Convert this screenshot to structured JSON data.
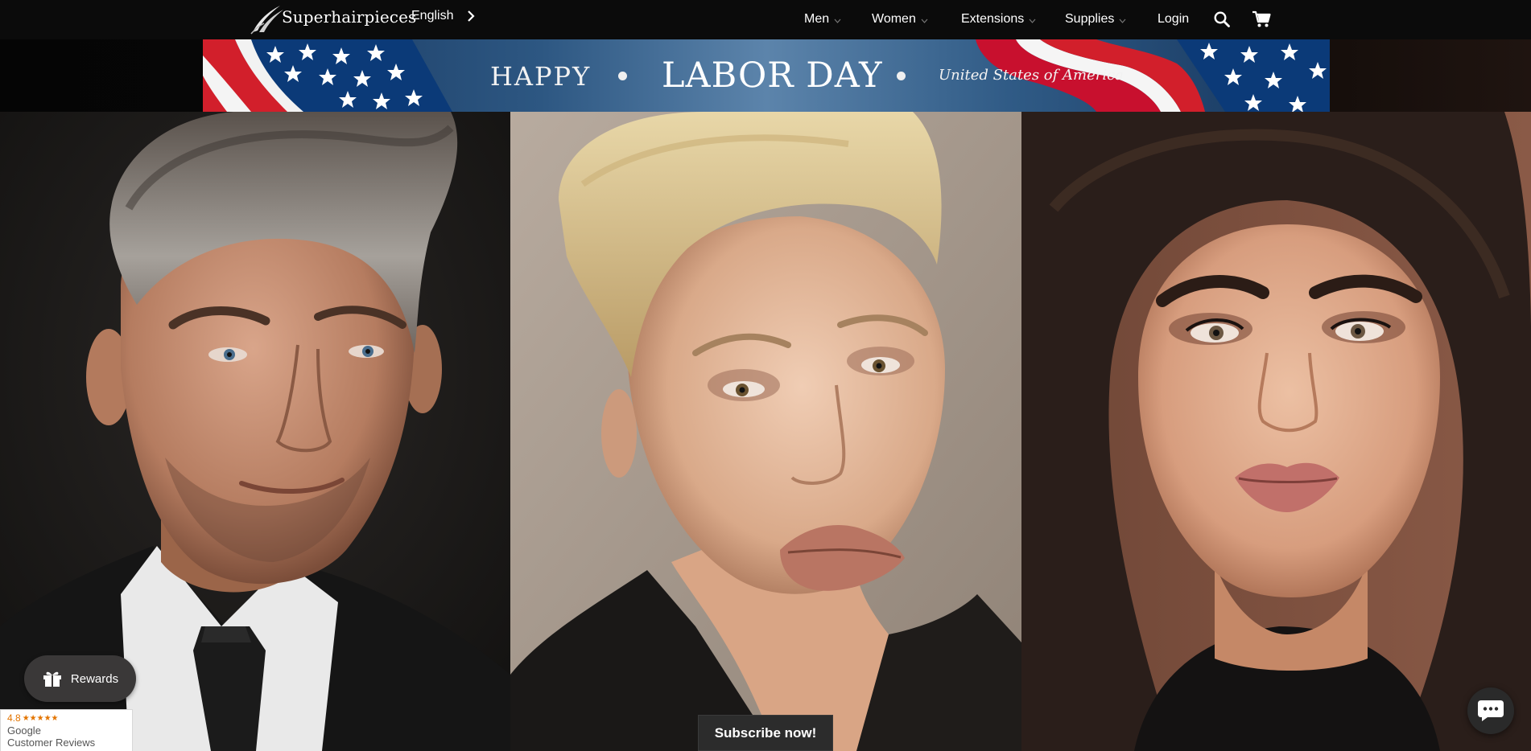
{
  "header": {
    "logo_text": "Superhairpieces",
    "language": "English",
    "nav": [
      {
        "label": "Men"
      },
      {
        "label": "Women"
      },
      {
        "label": "Extensions"
      },
      {
        "label": "Supplies"
      }
    ],
    "login_label": "Login",
    "icons": {
      "language_next": "chevron-right-icon",
      "search": "search-icon",
      "cart": "cart-icon",
      "nav_caret": "chevron-down-icon"
    }
  },
  "banner": {
    "happy": "HAPPY",
    "labor_day": "LABOR DAY",
    "country": "United States of America",
    "colors": {
      "flag_red": "#c8102e",
      "flag_blue": "#0a3a7a",
      "banner_blue": "#3d6a95"
    }
  },
  "hero": {
    "panels": [
      {
        "subject": "man-portrait",
        "background": "#1c1b1a"
      },
      {
        "subject": "blonde-woman-portrait",
        "background": "#a7998c"
      },
      {
        "subject": "brunette-woman-portrait",
        "background": "#7d5040"
      }
    ]
  },
  "widgets": {
    "rewards_label": "Rewards",
    "rewards_icon": "gift-icon",
    "google": {
      "score": "4.8",
      "stars": "★★★★★",
      "brand": "Google",
      "subtitle": "Customer Reviews"
    },
    "subscribe_label": "Subscribe now!",
    "chat_icon": "chat-bubble-icon"
  }
}
